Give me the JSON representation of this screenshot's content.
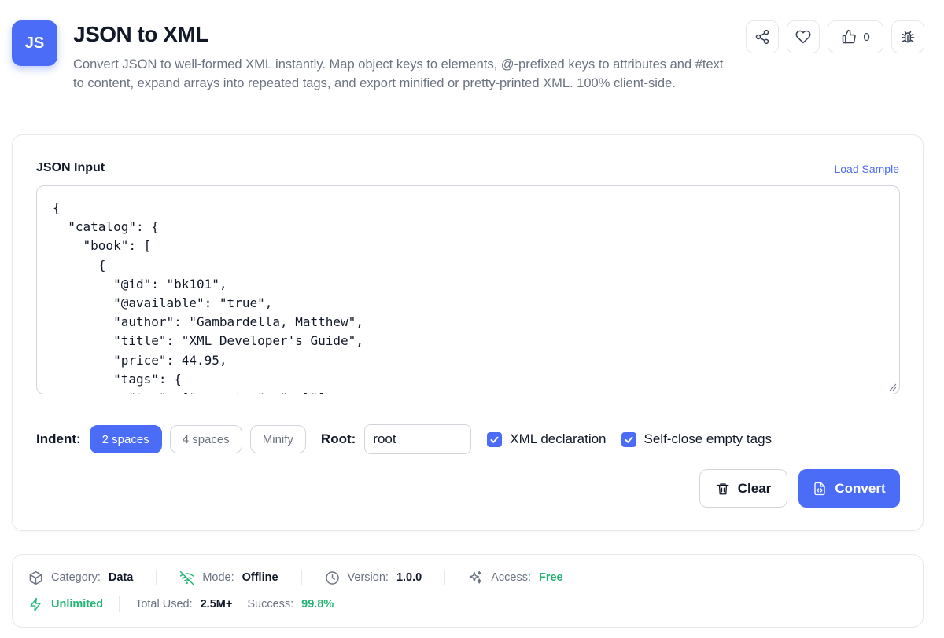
{
  "header": {
    "logo": "JS",
    "title": "JSON to XML",
    "description": "Convert JSON to well-formed XML instantly. Map object keys to elements, @-prefixed keys to attributes and #text to content, expand arrays into repeated tags, and export minified or pretty-printed XML. 100% client-side.",
    "like_count": "0",
    "icons": [
      "share-icon",
      "heart-icon",
      "thumbs-up-icon",
      "bug-icon"
    ]
  },
  "input": {
    "label": "JSON Input",
    "load_sample": "Load Sample",
    "content": "{\n  \"catalog\": {\n    \"book\": [\n      {\n        \"@id\": \"bk101\",\n        \"@available\": \"true\",\n        \"author\": \"Gambardella, Matthew\",\n        \"title\": \"XML Developer's Guide\",\n        \"price\": 44.95,\n        \"tags\": {\n          \"tag\": [\"computer\", \"xml\"]"
  },
  "options": {
    "indent_label": "Indent:",
    "indent_options": [
      "2 spaces",
      "4 spaces",
      "Minify"
    ],
    "indent_selected": "2 spaces",
    "root_label": "Root:",
    "root_value": "root",
    "xml_declaration_label": "XML declaration",
    "xml_declaration_checked": true,
    "self_close_label": "Self-close empty tags",
    "self_close_checked": true
  },
  "buttons": {
    "clear": "Clear",
    "convert": "Convert"
  },
  "meta": {
    "category_key": "Category:",
    "category_val": "Data",
    "mode_key": "Mode:",
    "mode_val": "Offline",
    "version_key": "Version:",
    "version_val": "1.0.0",
    "access_key": "Access:",
    "access_val": "Free",
    "unlimited": "Unlimited",
    "total_used_key": "Total Used:",
    "total_used_val": "2.5M+",
    "success_key": "Success:",
    "success_val": "99.8%"
  },
  "colors": {
    "accent": "#4a6cf7",
    "success": "#22b573",
    "muted": "#6b7280"
  }
}
